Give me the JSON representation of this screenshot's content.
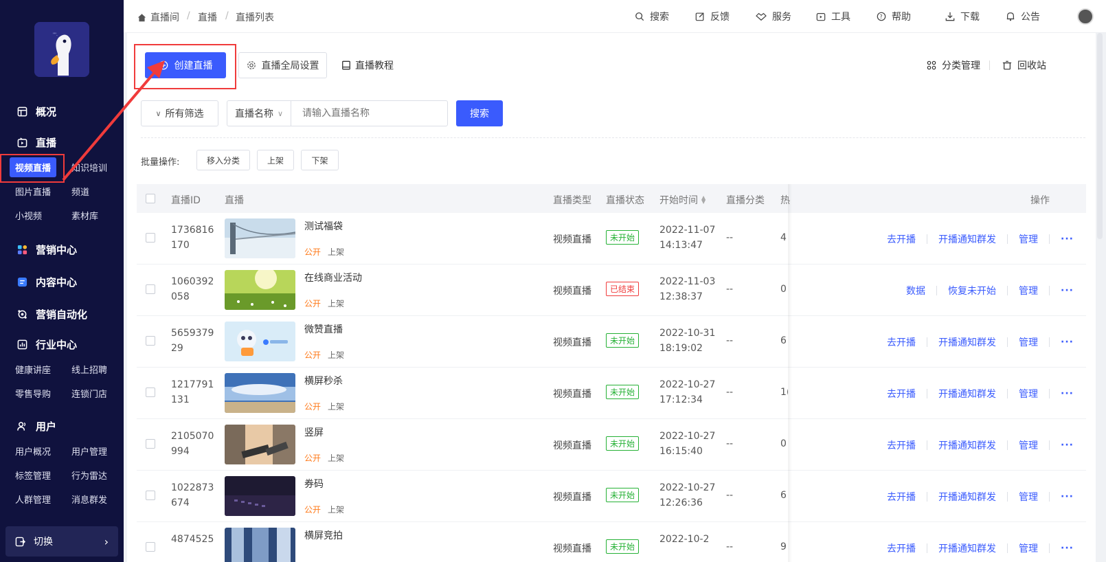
{
  "sidebar": {
    "overview": "概况",
    "live": "直播",
    "live_items": [
      "视频直播",
      "知识培训",
      "图片直播",
      "频道",
      "小视频",
      "素材库"
    ],
    "marketing": "营销中心",
    "content": "内容中心",
    "automation": "营销自动化",
    "industry": "行业中心",
    "industry_items": [
      "健康讲座",
      "线上招聘",
      "零售导购",
      "连锁门店"
    ],
    "user": "用户",
    "user_items": [
      "用户概况",
      "用户管理",
      "标签管理",
      "行为雷达",
      "人群管理",
      "消息群发"
    ],
    "switch": "切换",
    "switch_arrow": "›"
  },
  "breadcrumb": [
    "直播间",
    "/",
    "直播",
    "/",
    "直播列表"
  ],
  "topnav": [
    "搜索",
    "反馈",
    "服务",
    "工具",
    "帮助",
    "下载",
    "公告"
  ],
  "toolbar": {
    "create": "创建直播",
    "global_settings": "直播全局设置",
    "tutorial": "直播教程",
    "category_manage": "分类管理",
    "recycle": "回收站"
  },
  "filter": {
    "all_filter": "所有筛选",
    "field": "直播名称",
    "placeholder": "请输入直播名称",
    "search": "搜索"
  },
  "batch": {
    "label": "批量操作:",
    "move": "移入分类",
    "on": "上架",
    "off": "下架"
  },
  "table": {
    "headers": [
      "直播ID",
      "直播",
      "直播类型",
      "直播状态",
      "开始时间",
      "直播分类",
      "热",
      "操作"
    ],
    "rows": [
      {
        "id": "1736816170",
        "title": "测试福袋",
        "public": "公开",
        "shelf": "上架",
        "type": "视频直播",
        "status": "未开始",
        "time": "2022-11-07 14:13:47",
        "cat": "--",
        "hot": "4",
        "ops": [
          "去开播",
          "开播通知群发",
          "管理"
        ]
      },
      {
        "id": "1060392058",
        "title": "在线商业活动",
        "public": "公开",
        "shelf": "上架",
        "type": "视频直播",
        "status": "已结束",
        "time": "2022-11-03 12:38:37",
        "cat": "--",
        "hot": "0",
        "ops": [
          "数据",
          "恢复未开始",
          "管理"
        ]
      },
      {
        "id": "565937929",
        "title": "微赞直播",
        "public": "公开",
        "shelf": "上架",
        "type": "视频直播",
        "status": "未开始",
        "time": "2022-10-31 18:19:02",
        "cat": "--",
        "hot": "6",
        "ops": [
          "去开播",
          "开播通知群发",
          "管理"
        ]
      },
      {
        "id": "1217791131",
        "title": "横屏秒杀",
        "public": "公开",
        "shelf": "上架",
        "type": "视频直播",
        "status": "未开始",
        "time": "2022-10-27 17:12:34",
        "cat": "--",
        "hot": "1(",
        "ops": [
          "去开播",
          "开播通知群发",
          "管理"
        ]
      },
      {
        "id": "2105070994",
        "title": "竖屏",
        "public": "公开",
        "shelf": "上架",
        "type": "视频直播",
        "status": "未开始",
        "time": "2022-10-27 16:15:40",
        "cat": "--",
        "hot": "0",
        "ops": [
          "去开播",
          "开播通知群发",
          "管理"
        ]
      },
      {
        "id": "1022873674",
        "title": "券码",
        "public": "公开",
        "shelf": "上架",
        "type": "视频直播",
        "status": "未开始",
        "time": "2022-10-27 12:26:36",
        "cat": "--",
        "hot": "6",
        "ops": [
          "去开播",
          "开播通知群发",
          "管理"
        ]
      },
      {
        "id": "4874525",
        "title": "横屏竞拍",
        "public": "",
        "shelf": "",
        "type": "视频直播",
        "status": "未开始",
        "time": "2022-10-2",
        "cat": "--",
        "hot": "9",
        "ops": [
          "去开播",
          "开播通知群发",
          "管理"
        ]
      }
    ],
    "more": "···"
  },
  "colors": {
    "accent": "#3a5bfd",
    "sidebar": "#10123e",
    "annotation": "#f03b3b",
    "green": "#25b135",
    "public": "#ff7a1a"
  }
}
